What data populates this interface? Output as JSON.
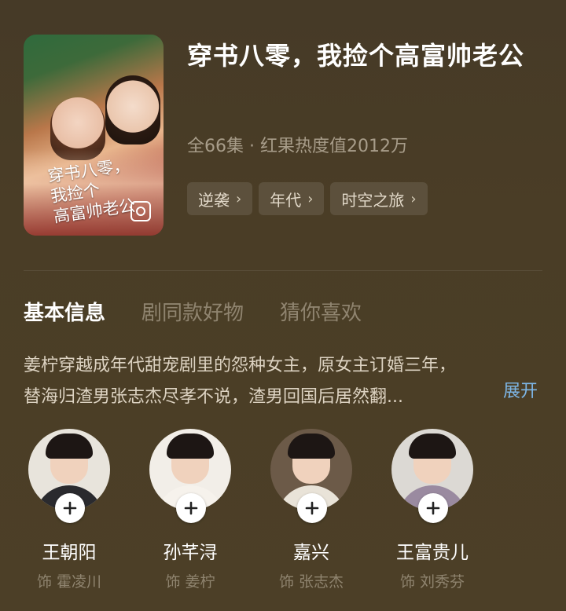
{
  "drama": {
    "title": "穿书八零，我捡个高富帅老公",
    "meta": "全66集 · 红果热度值2012万",
    "poster_text": "穿书八零，\n我捡个\n高富帅老公",
    "tags": [
      {
        "label": "逆袭"
      },
      {
        "label": "年代"
      },
      {
        "label": "时空之旅"
      }
    ]
  },
  "tabs": [
    {
      "label": "基本信息",
      "active": true
    },
    {
      "label": "剧同款好物",
      "active": false
    },
    {
      "label": "猜你喜欢",
      "active": false
    }
  ],
  "synopsis": {
    "line1": "姜柠穿越成年代甜宠剧里的怨种女主，原女主订婚三年，",
    "line2": "替海归渣男张志杰尽孝不说，渣男回国后居然翻...",
    "expand_label": "展开"
  },
  "cast": [
    {
      "name": "王朝阳",
      "role": "饰 霍凌川",
      "avatar_bg": "#e8e4dc",
      "shoulders": "#2a2a2e"
    },
    {
      "name": "孙芊浔",
      "role": "饰 姜柠",
      "avatar_bg": "#f2eee8",
      "shoulders": "#f6f2ec"
    },
    {
      "name": "嘉兴",
      "role": "饰 张志杰",
      "avatar_bg": "#6c5a48",
      "shoulders": "#e9e3d8"
    },
    {
      "name": "王富贵儿",
      "role": "饰 刘秀芬",
      "avatar_bg": "#dcd9d4",
      "shoulders": "#9a8aa0"
    }
  ],
  "colors": {
    "background": "#4a3d26",
    "expand_link": "#7db6e6",
    "muted_text": "#8f846f"
  }
}
